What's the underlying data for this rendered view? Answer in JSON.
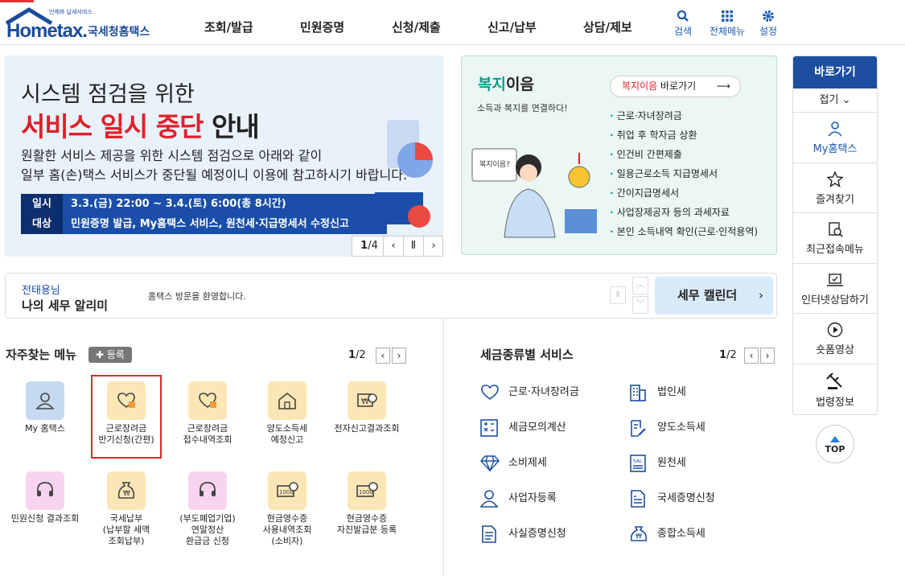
{
  "header": {
    "logo_brand": "Hometax.",
    "logo_tag": "언제봐 납세서비스",
    "logo_name": "국세청홈택스",
    "nav": [
      "조회/발급",
      "민원증명",
      "신청/제출",
      "신고/납부",
      "상담/제보"
    ],
    "utils": [
      "검색",
      "전체메뉴",
      "설정"
    ]
  },
  "banner": {
    "line1": "시스템 점검을 위한",
    "line2_red": "서비스 일시 중단",
    "line2_black": " 안내",
    "desc1": "원활한 서비스 제공을 위한 시스템 점검으로 아래와 같이",
    "desc2": "일부 홈(손)택스 서비스가 중단될 예정이니 이용에 참고하시기 바랍니다.",
    "row1_key": "일시",
    "row1_val": "3.3.(금) 22:00 ~ 3.4.(토) 6:00(총 8시간)",
    "row2_key": "대상",
    "row2_val": "민원증명 발급, My홈택스 서비스, 원천세·지급명세서 수정신고",
    "page_current": "1",
    "page_total": "/4"
  },
  "welfare": {
    "title_g": "복지",
    "title_b": "이음",
    "subtitle": "소득과 복지를 연결하다!",
    "link_red": "복지이음",
    "link_rest": " 바로가기",
    "items": [
      "근로·자녀장려금",
      "취업 후 학자금 상환",
      "인건비 간편제출",
      "일용근로소득 지급명세서",
      "간이지급명세서",
      "사업장제공자 등의 과세자료",
      "본인 소득내역 확인(근로·인적용역)"
    ],
    "bubble": "복지이음?"
  },
  "quick": {
    "title": "바로가기",
    "fold": "접기 ⌄",
    "items": [
      "My홈택스",
      "즐겨찾기",
      "최근접속메뉴",
      "인터넷상담하기",
      "숏폼영상",
      "법령정보"
    ],
    "top": "TOP"
  },
  "notice": {
    "name": "전태용님",
    "title": "나의 세무 알리미",
    "message": "홈택스 방문을 환영합니다.",
    "calendar": "세무 캘린더"
  },
  "favorites": {
    "title": "자주찾는 메뉴",
    "add": "등록",
    "page": "1",
    "total": "/2",
    "items": [
      [
        "My 홈택스"
      ],
      [
        "근로장려금",
        "반기신청(간편)"
      ],
      [
        "근로장려금",
        "접수내역조회"
      ],
      [
        "양도소득세",
        "예정신고"
      ],
      [
        "전자신고결과조회"
      ],
      [
        "민원신청 결과조회"
      ],
      [
        "국세납부",
        "(납부할 세액",
        "조회납부)"
      ],
      [
        "(부도폐업기업)",
        "연말정산",
        "환급금 신청"
      ],
      [
        "현금영수증",
        "사용내역조회",
        "(소비자)"
      ],
      [
        "현금영수증",
        "자진발급분 등록"
      ]
    ]
  },
  "taxes": {
    "title": "세금종류별 서비스",
    "page": "1",
    "total": "/2",
    "left": [
      "근로·자녀장려금",
      "세금모의계산",
      "소비제세",
      "사업자등록",
      "사실증명신청"
    ],
    "right": [
      "법인세",
      "양도소득세",
      "원천세",
      "국세증명신청",
      "종합소득세"
    ]
  },
  "colors": {
    "brand": "#1b4c9c",
    "accent_red": "#e0202a",
    "welfare_green": "#0c9b8a"
  }
}
